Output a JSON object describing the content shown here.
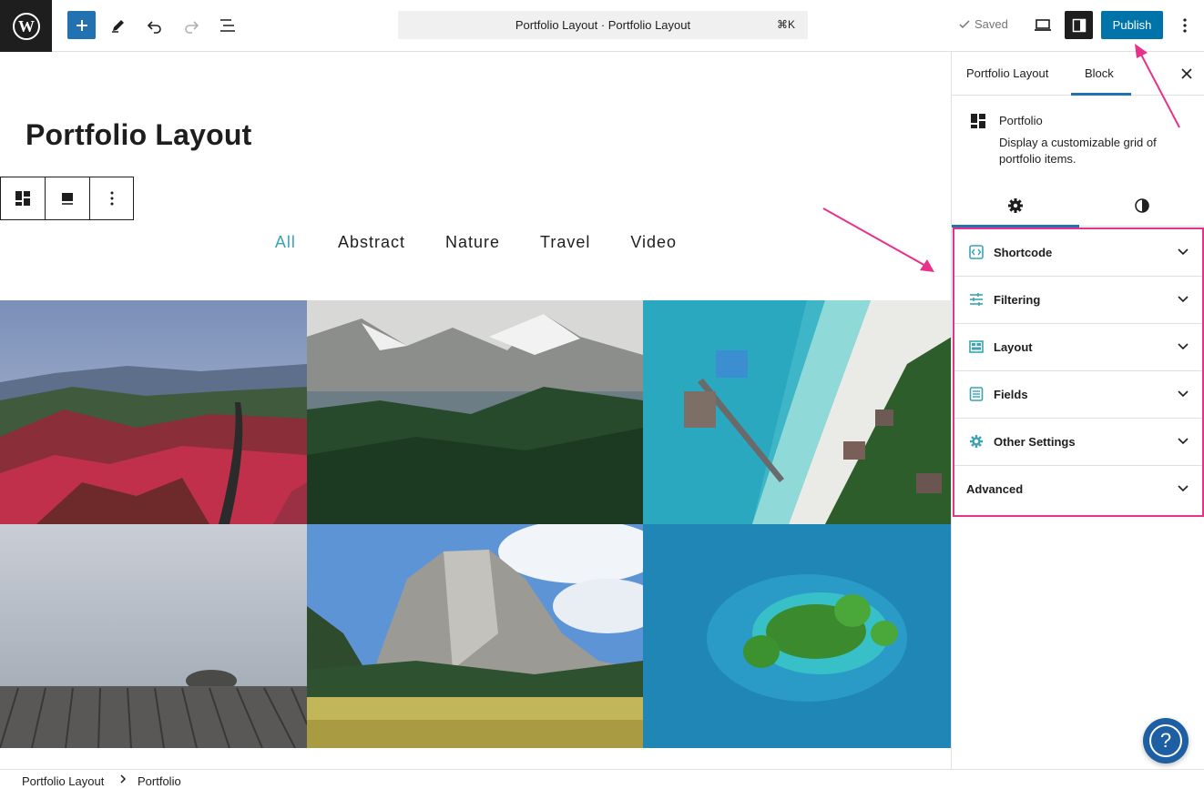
{
  "topbar": {
    "command_title": "Portfolio Layout · Portfolio Layout",
    "command_shortcut": "⌘K",
    "saved_label": "Saved",
    "publish_label": "Publish"
  },
  "page": {
    "title": "Portfolio Layout"
  },
  "filters": [
    "All",
    "Abstract",
    "Nature",
    "Travel",
    "Video"
  ],
  "sidebar": {
    "tabs": [
      "Portfolio Layout",
      "Block"
    ],
    "block_name": "Portfolio",
    "block_description": "Display a customizable grid of portfolio items.",
    "panels": [
      {
        "label": "Shortcode",
        "icon": "shortcode-icon"
      },
      {
        "label": "Filtering",
        "icon": "sliders-icon"
      },
      {
        "label": "Layout",
        "icon": "layout-icon"
      },
      {
        "label": "Fields",
        "icon": "fields-icon"
      },
      {
        "label": "Other Settings",
        "icon": "gear-icon"
      },
      {
        "label": "Advanced",
        "icon": ""
      }
    ]
  },
  "breadcrumbs": [
    "Portfolio Layout",
    "Portfolio"
  ],
  "colors": {
    "accent": "#3aa3b8",
    "primary": "#0073aa",
    "highlight": "#e8318b"
  }
}
